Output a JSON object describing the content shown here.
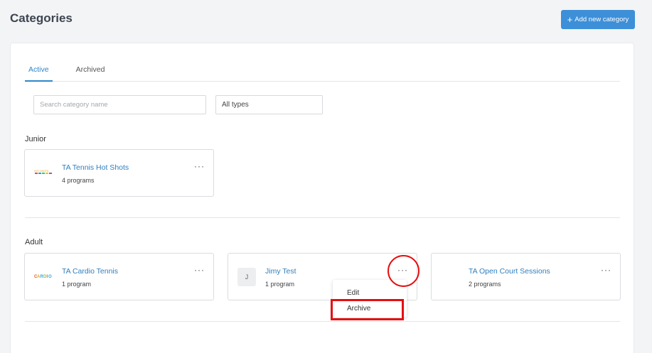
{
  "header": {
    "title": "Categories",
    "add_button_label": "Add new category",
    "add_button_icon": "plus-icon"
  },
  "tabs": [
    {
      "label": "Active",
      "active": true
    },
    {
      "label": "Archived",
      "active": false
    }
  ],
  "filters": {
    "search_placeholder": "Search category name",
    "search_value": "",
    "type_selected": "All types"
  },
  "sections": [
    {
      "label": "Junior",
      "cards": [
        {
          "name": "TA Tennis Hot Shots",
          "count": "4 programs",
          "logo": "hot-shots-logo",
          "more": "···"
        }
      ]
    },
    {
      "label": "Adult",
      "cards": [
        {
          "name": "TA Cardio Tennis",
          "count": "1 program",
          "logo": "cardio-logo",
          "logo_text": "CARDIO",
          "more": "···"
        },
        {
          "name": "Jimy Test",
          "count": "1 program",
          "avatar_letter": "J",
          "more": "···"
        },
        {
          "name": "TA Open Court Sessions",
          "count": "2 programs",
          "more": "···"
        }
      ]
    }
  ],
  "context_menu": {
    "items": [
      {
        "label": "Edit"
      },
      {
        "label": "Archive"
      }
    ]
  },
  "colors": {
    "accent": "#3d8fd8",
    "link": "#2f7fbf",
    "highlight": "#e40f10",
    "background": "#f3f4f6"
  }
}
